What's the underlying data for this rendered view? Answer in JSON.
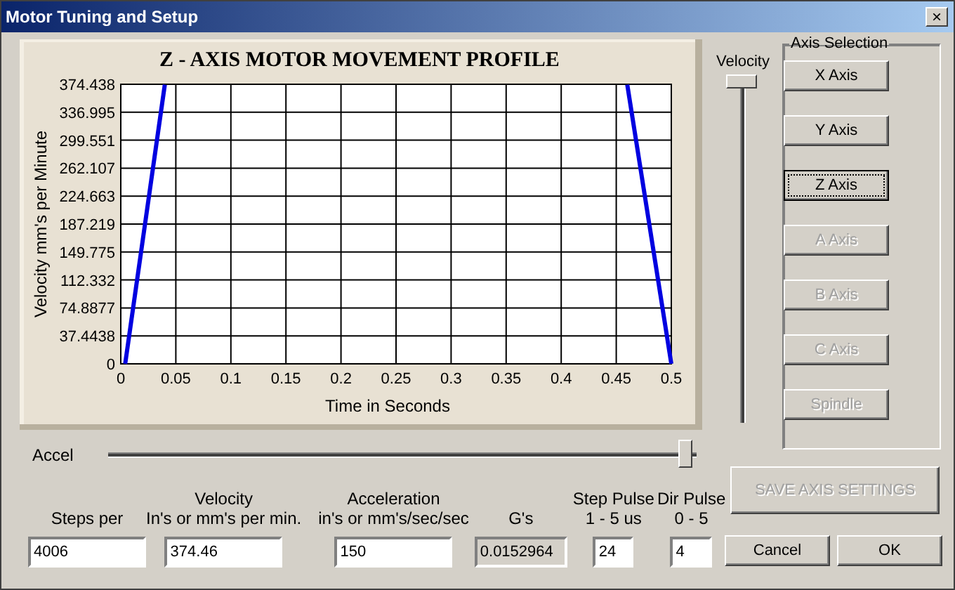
{
  "window": {
    "title": "Motor Tuning and Setup",
    "close": "×"
  },
  "chart": {
    "chart_data": {
      "type": "line",
      "title": "Z - AXIS MOTOR MOVEMENT PROFILE",
      "xlabel": "Time in Seconds",
      "ylabel": "Velocity mm's per Minute",
      "x": [
        0.004,
        0.04,
        0.46,
        0.5
      ],
      "grid": true,
      "series": [
        {
          "color": "#0000e0",
          "values": [
            0,
            374,
            null,
            null
          ]
        },
        {
          "color": "#0000e0",
          "values": [
            null,
            null,
            374,
            0
          ]
        }
      ],
      "xlim": [
        0,
        0.5
      ],
      "ylim": [
        0,
        374.438
      ],
      "xticks": [
        0,
        0.05,
        0.1,
        0.15,
        0.2,
        0.25,
        0.3,
        0.35,
        0.4,
        0.45,
        0.5
      ],
      "yticks": [
        0,
        37.4438,
        74.8877,
        112.332,
        149.775,
        187.219,
        224.663,
        262.107,
        299.551,
        336.995,
        374.438
      ]
    }
  },
  "velocity_slider": {
    "label": "Velocity",
    "level": 1
  },
  "accel_slider": {
    "label": "Accel",
    "level": 0.98
  },
  "axis_selection": {
    "title": "Axis Selection",
    "buttons": [
      {
        "label": "X Axis",
        "enabled": true,
        "selected": false
      },
      {
        "label": "Y Axis",
        "enabled": true,
        "selected": false
      },
      {
        "label": "Z Axis",
        "enabled": true,
        "selected": true
      },
      {
        "label": "A Axis",
        "enabled": false,
        "selected": false
      },
      {
        "label": "B Axis",
        "enabled": false,
        "selected": false
      },
      {
        "label": "C Axis",
        "enabled": false,
        "selected": false
      },
      {
        "label": "Spindle",
        "enabled": false,
        "selected": false
      }
    ]
  },
  "fields": [
    {
      "label": [
        "Steps per"
      ],
      "value": "4006",
      "readonly": false
    },
    {
      "label": [
        "Velocity",
        "In's or mm's per min."
      ],
      "value": "374.46",
      "readonly": false
    },
    {
      "label": [
        "Acceleration",
        "in's or mm's/sec/sec"
      ],
      "value": "150",
      "readonly": false
    },
    {
      "label": [
        "G's"
      ],
      "value": "0.0152964",
      "readonly": true
    },
    {
      "label": [
        "Step Pulse",
        "1 - 5 us"
      ],
      "value": "24",
      "readonly": false
    },
    {
      "label": [
        "Dir Pulse",
        "0 - 5"
      ],
      "value": "4",
      "readonly": false
    }
  ],
  "save_button": {
    "label": "SAVE AXIS SETTINGS",
    "enabled": false
  },
  "buttons": [
    "Cancel",
    "OK"
  ]
}
